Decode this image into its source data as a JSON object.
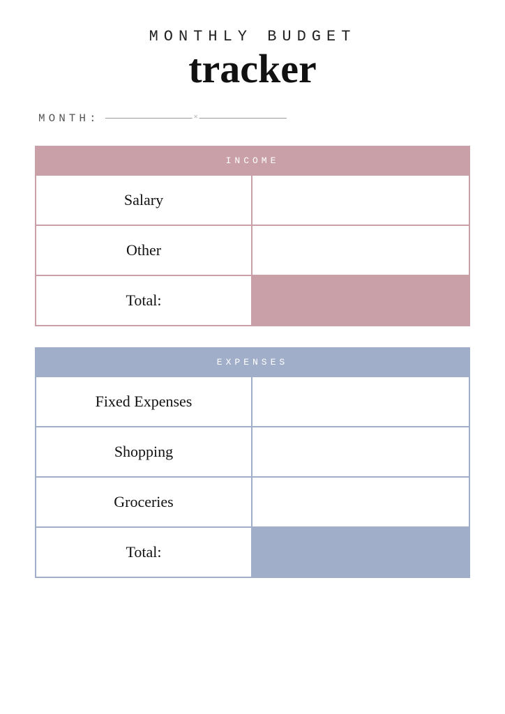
{
  "header": {
    "title_top": "MONTHLY BUDGET",
    "title_script": "tracker"
  },
  "month": {
    "label": "MONTH:"
  },
  "income": {
    "header": "INCOME",
    "rows": [
      {
        "label": "Salary",
        "value": ""
      },
      {
        "label": "Other",
        "value": ""
      },
      {
        "label": "Total:",
        "value": ""
      }
    ]
  },
  "expenses": {
    "header": "EXPENSES",
    "rows": [
      {
        "label": "Fixed Expenses",
        "value": ""
      },
      {
        "label": "Shopping",
        "value": ""
      },
      {
        "label": "Groceries",
        "value": ""
      },
      {
        "label": "Total:",
        "value": ""
      }
    ]
  }
}
